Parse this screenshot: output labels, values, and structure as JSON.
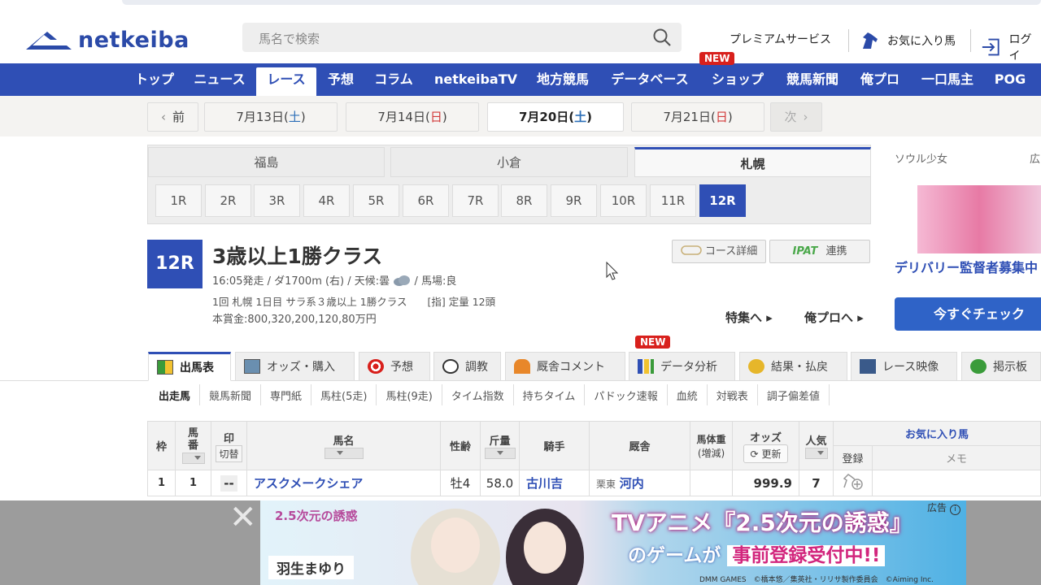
{
  "header": {
    "logo": "netkeiba",
    "search_placeholder": "馬名で検索",
    "premium": "プレミアムサービス",
    "favorites": "お気に入り馬",
    "login": "ログイ"
  },
  "nav": {
    "items": [
      "トップ",
      "ニュース",
      "レース",
      "予想",
      "コラム",
      "netkeibaTV",
      "地方競馬",
      "データベース",
      "ショップ",
      "競馬新聞",
      "俺プロ",
      "一口馬主",
      "POG"
    ],
    "new_badge": "NEW"
  },
  "dates": {
    "prev": "前",
    "next": "次",
    "days": [
      {
        "date": "7月13日",
        "dow": "土"
      },
      {
        "date": "7月14日",
        "dow": "日"
      },
      {
        "date": "7月20日",
        "dow": "土"
      },
      {
        "date": "7月21日",
        "dow": "日"
      }
    ]
  },
  "venues": [
    "福島",
    "小倉",
    "札幌"
  ],
  "races": [
    "1R",
    "2R",
    "3R",
    "4R",
    "5R",
    "6R",
    "7R",
    "8R",
    "9R",
    "10R",
    "11R",
    "12R"
  ],
  "race": {
    "num": "12R",
    "title": "3歳以上1勝クラス",
    "line1": "16:05発走 / ダ1700m (右) / 天候:曇",
    "line1b": "/ 馬場:良",
    "line2": "1回 札幌 1日目 サラ系３歳以上 1勝クラス　　[指] 定量 12頭",
    "line3": "本賞金:800,320,200,120,80万円",
    "course_btn": "コース詳細",
    "ipat": "IPAT",
    "ipat_link": "連携",
    "tokushu": "特集へ ▸",
    "orepro": "俺プロへ ▸"
  },
  "sidebar": {
    "top_label": "ソウル少女",
    "top_right": "広",
    "title": "デリバリー監督者募集中",
    "button": "今すぐチェック"
  },
  "tabs": [
    "出馬表",
    "オッズ・購入",
    "予想",
    "調教",
    "厩舎コメント",
    "データ分析",
    "結果・払戻",
    "レース映像",
    "掲示板"
  ],
  "tab_new": "NEW",
  "subtabs": [
    "出走馬",
    "競馬新聞",
    "専門紙",
    "馬柱(5走)",
    "馬柱(9走)",
    "タイム指数",
    "持ちタイム",
    "パドック速報",
    "血統",
    "対戦表",
    "調子偏差値"
  ],
  "table": {
    "h_waku": "枠",
    "h_uma": "馬\n番",
    "h_in": "印",
    "h_kiri": "切替",
    "h_name": "馬名",
    "h_sex": "性齢",
    "h_kin": "斤量",
    "h_jockey": "騎手",
    "h_stable": "厩舎",
    "h_weight1": "馬体重",
    "h_weight2": "(増減)",
    "h_odds": "オッズ",
    "h_update": "更新",
    "h_pop": "人気",
    "h_fav": "お気に入り馬",
    "h_reg": "登録",
    "h_memo": "メモ",
    "row": {
      "waku": "1",
      "uma": "1",
      "in": "--",
      "name": "アスクメークシェア",
      "sex": "牡4",
      "kin": "58.0",
      "jockey": "古川吉",
      "area": "栗東",
      "trainer": "河内",
      "odds": "999.9",
      "pop": "7"
    }
  },
  "bottom_ad": {
    "label": "広告",
    "title": "TVアニメ『2.5次元の誘惑』",
    "sub1": "のゲームが",
    "sub2": "事前登録受付中!!",
    "name": "羽生まゆり",
    "logo": "2.5次元の誘惑",
    "footer": "DMM GAMES　©橋本悠／集英社・リリサ製作委員会　©Aiming Inc."
  }
}
